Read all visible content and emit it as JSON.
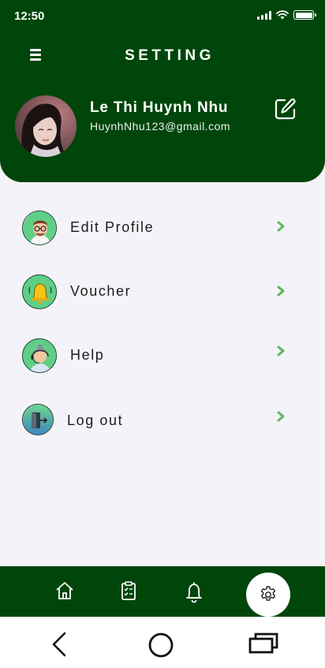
{
  "status_bar": {
    "time": "12:50",
    "battery_level": 1.0
  },
  "header": {
    "title": "SETTING",
    "menu_icon": "hamburger-menu-icon",
    "edit_icon": "edit-square-icon"
  },
  "profile": {
    "name": "Le Thi Huynh Nhu",
    "email": "HuynhNhu123@gmail.com"
  },
  "menu": {
    "items": [
      {
        "label": "Edit Profile",
        "icon": "person-glasses-icon"
      },
      {
        "label": "Voucher",
        "icon": "bell-icon"
      },
      {
        "label": "Help",
        "icon": "support-agent-icon"
      },
      {
        "label": "Log out",
        "icon": "logout-door-icon"
      }
    ]
  },
  "bottom_nav": {
    "items": [
      "home-icon",
      "clipboard-list-icon",
      "bell-icon",
      "settings-gear-icon"
    ],
    "active": "settings-gear-icon"
  },
  "colors": {
    "brand_green": "#00460b",
    "background": "#f4f3f9",
    "chevron_green": "#5cb85c",
    "badge_green": "#5fcf87"
  }
}
